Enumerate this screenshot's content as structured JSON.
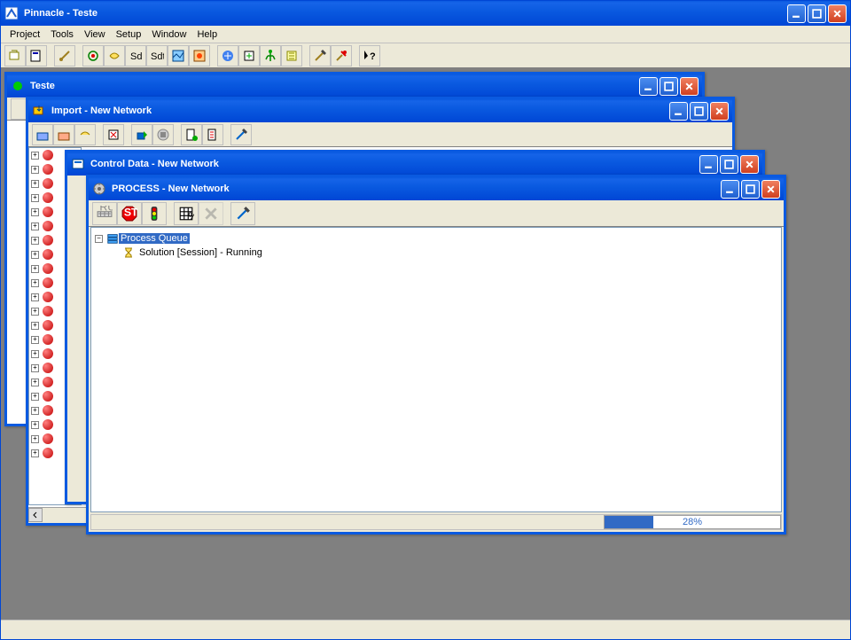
{
  "app": {
    "title": "Pinnacle - Teste"
  },
  "menu": {
    "project": "Project",
    "tools": "Tools",
    "view": "View",
    "setup": "Setup",
    "window": "Window",
    "help": "Help"
  },
  "main_toolbar_icons": [
    "tool-a",
    "tool-b",
    "tool-c",
    "tool-d",
    "tool-e",
    "tool-f",
    "tool-g",
    "tool-h",
    "tool-i",
    "tool-j",
    "tool-k",
    "tool-l",
    "tool-m",
    "tool-n",
    "tool-o",
    "tool-p",
    "tool-help"
  ],
  "win_teste": {
    "title": "Teste"
  },
  "win_import": {
    "title": "Import - New Network"
  },
  "win_control": {
    "title": "Control Data - New Network"
  },
  "win_process": {
    "title": "PROCESS - New Network",
    "tree_root": "Process Queue",
    "tree_child": "Solution [Session] - Running",
    "progress_percent": "28%",
    "progress_value": 28
  },
  "tree_nodes_count": 22,
  "colors": {
    "xp_blue": "#0a5ae0",
    "xp_face": "#ece9d8",
    "select": "#316ac5"
  }
}
